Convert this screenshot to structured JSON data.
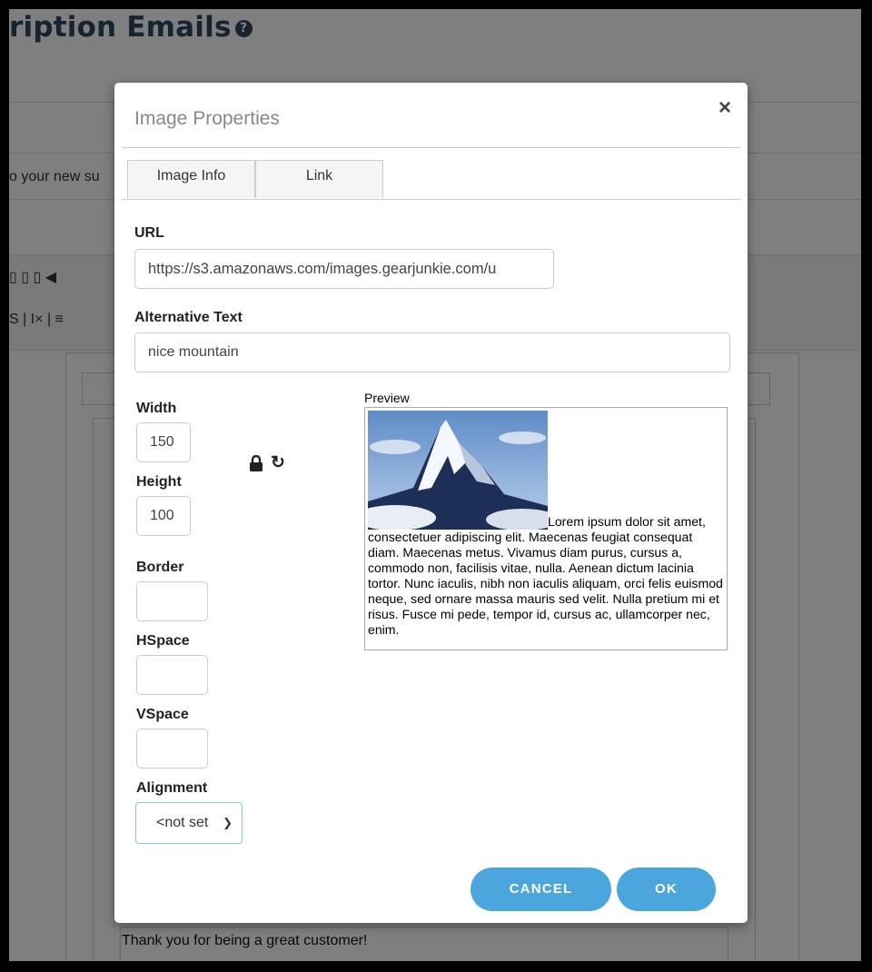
{
  "background": {
    "page_title": "ription Emails",
    "help_icon": "question-circle-icon",
    "partial_text": "o your new su",
    "footer_text": "Thank you for being a great customer!"
  },
  "dialog": {
    "title": "Image Properties",
    "close_label": "×",
    "tabs": [
      {
        "label": "Image Info",
        "active": true
      },
      {
        "label": "Link",
        "active": false
      }
    ],
    "url": {
      "label": "URL",
      "value": "https://s3.amazonaws.com/images.gearjunkie.com/u"
    },
    "alt": {
      "label": "Alternative Text",
      "value": "nice mountain"
    },
    "width": {
      "label": "Width",
      "value": "150"
    },
    "height": {
      "label": "Height",
      "value": "100"
    },
    "border": {
      "label": "Border",
      "value": ""
    },
    "hspace": {
      "label": "HSpace",
      "value": ""
    },
    "vspace": {
      "label": "VSpace",
      "value": ""
    },
    "alignment": {
      "label": "Alignment",
      "value": "<not set>"
    },
    "lock_icon": "lock-icon",
    "reset_icon": "reset-size-icon",
    "preview": {
      "label": "Preview",
      "text": "Lorem ipsum dolor sit amet, consectetuer adipiscing elit. Maecenas feugiat consequat diam. Maecenas metus. Vivamus diam purus, cursus a, commodo non, facilisis vitae, nulla. Aenean dictum lacinia tortor. Nunc iaculis, nibh non iaculis aliquam, orci felis euismod neque, sed ornare massa mauris sed velit. Nulla pretium mi et risus. Fusce mi pede, tempor id, cursus ac, ullamcorper nec, enim."
    },
    "buttons": {
      "cancel": "CANCEL",
      "ok": "OK"
    },
    "accent_color": "#4aa6dd"
  }
}
